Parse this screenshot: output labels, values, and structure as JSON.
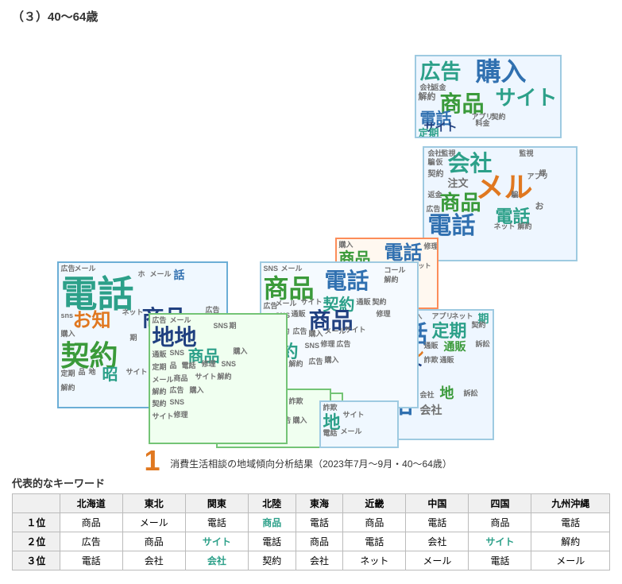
{
  "page": {
    "title": "（３）40～64歳",
    "caption": "消費生活相談の地域傾向分析結果（2023年7月～9月・40～64歳）",
    "section_label": "代表的なキーワード"
  },
  "table": {
    "headers": [
      "",
      "北海道",
      "東北",
      "関東",
      "北陸",
      "東海",
      "近畿",
      "中国",
      "四国",
      "九州沖縄"
    ],
    "rows": [
      {
        "rank": "１位",
        "values": [
          "商品",
          "メール",
          "電話",
          "商品",
          "電話",
          "商品",
          "電話",
          "商品",
          "電話"
        ],
        "highlights": [
          false,
          false,
          false,
          true,
          false,
          false,
          false,
          false,
          false
        ]
      },
      {
        "rank": "２位",
        "values": [
          "広告",
          "商品",
          "サイト",
          "電話",
          "商品",
          "電話",
          "会社",
          "サイト",
          "解約"
        ],
        "highlights": [
          false,
          false,
          true,
          false,
          false,
          false,
          false,
          true,
          false
        ]
      },
      {
        "rank": "３位",
        "values": [
          "電話",
          "会社",
          "会社",
          "契約",
          "会社",
          "ネット",
          "メール",
          "電話",
          "メール"
        ],
        "highlights": [
          false,
          false,
          true,
          false,
          false,
          false,
          false,
          false,
          false
        ]
      }
    ]
  }
}
